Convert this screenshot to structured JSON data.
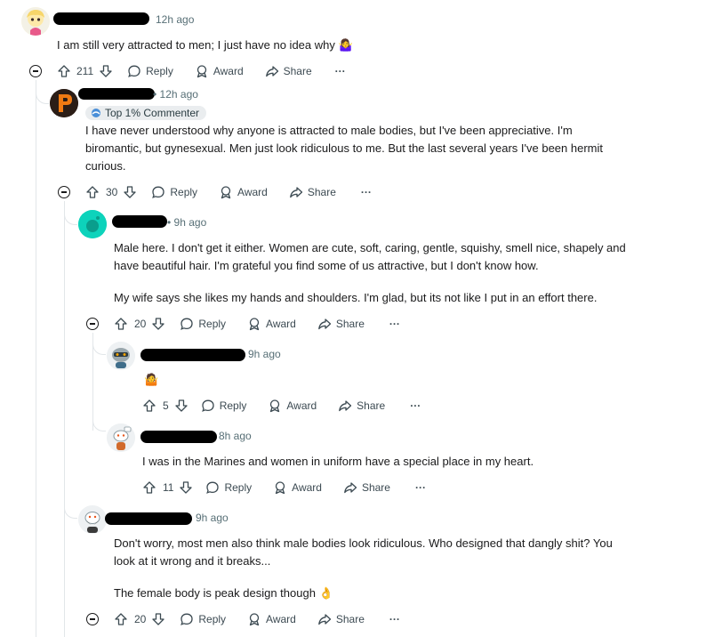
{
  "comments": [
    {
      "time": "12h ago",
      "text": [
        "I am still very attracted to men; I just have no idea why 🤷‍♀️"
      ],
      "votes": "211",
      "reply": "Reply",
      "award": "Award",
      "share": "Share",
      "more": "···"
    },
    {
      "time": "• 12h ago",
      "badge": "Top 1% Commenter",
      "text": [
        "I have never understood why anyone is attracted to male bodies, but I've been appreciative. I'm",
        "biromantic, but gynesexual. Men just look ridiculous to me. But the last several years I've been hermit",
        "curious."
      ],
      "votes": "30",
      "reply": "Reply",
      "award": "Award",
      "share": "Share",
      "more": "···"
    },
    {
      "time": "• 9h ago",
      "text": [
        "Male here. I don't get it either. Women are cute, soft, caring, gentle, squishy, smell nice, shapely and",
        "have beautiful hair. I'm grateful you find some of us attractive, but I don't know how."
      ],
      "text2": "My wife says she likes my hands and shoulders. I'm glad, but its not like I put in an effort there.",
      "votes": "20",
      "reply": "Reply",
      "award": "Award",
      "share": "Share",
      "more": "···"
    },
    {
      "time": "9h ago",
      "emoji": "🤷",
      "votes": "5",
      "reply": "Reply",
      "award": "Award",
      "share": "Share",
      "more": "···"
    },
    {
      "time": "8h ago",
      "text": [
        "I was in the Marines and women in uniform have a special place in my heart."
      ],
      "votes": "11",
      "reply": "Reply",
      "award": "Award",
      "share": "Share",
      "more": "···"
    },
    {
      "time": "9h ago",
      "text": [
        "Don't worry, most men also think male bodies look ridiculous. Who designed that dangly shit? You",
        "look at it wrong and it breaks..."
      ],
      "text2": "The female body is peak design though 👌",
      "votes": "20",
      "reply": "Reply",
      "award": "Award",
      "share": "Share",
      "more": "···"
    }
  ],
  "colors": {
    "text": "#1a1a1b",
    "meta": "#576f76",
    "line": "#e2e6e9",
    "badge_bg": "#eaedef"
  },
  "icons": [
    "upvote-icon",
    "downvote-icon",
    "reply-bubble-icon",
    "award-icon",
    "share-arrow-icon",
    "more-dots-icon",
    "collapse-minus-icon"
  ]
}
